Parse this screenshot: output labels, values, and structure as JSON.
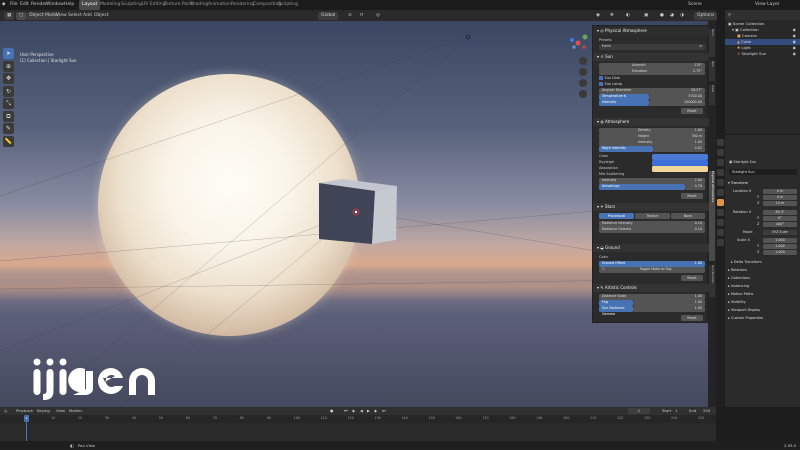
{
  "topbar": {
    "menus": [
      "File",
      "Edit",
      "Render",
      "Window",
      "Help"
    ],
    "workspaces": [
      "Layout",
      "Modeling",
      "Sculpting",
      "UV Editing",
      "Texture Paint",
      "Shading",
      "Animation",
      "Rendering",
      "Compositing",
      "Scripting"
    ],
    "active_workspace": "Layout",
    "scene": "Scene",
    "view_layer": "View Layer"
  },
  "viewport_header": {
    "mode": "Object Mode",
    "menus": [
      "View",
      "Select",
      "Add",
      "Object"
    ],
    "orientation": "Global",
    "options": "Options"
  },
  "viewport_info": {
    "line1": "User Perspective",
    "line2": "(1) Collection | Starlight Sun"
  },
  "logo_text": "ijigen",
  "npanel": {
    "title": "Physical Atmosphere",
    "presets_label": "Presets",
    "preset_value": "Earth",
    "sun": {
      "header": "Sun",
      "azimuth_label": "Azimuth",
      "azimuth": "270°",
      "elevation_label": "Elevation",
      "elevation": "2.72°",
      "sun_disk": "Sun Disk",
      "sun_lamp": "Sun Lamp",
      "angular_label": "Angular Diameter",
      "angular": "28.27°",
      "temp_label": "Temperature K",
      "temp": "5700.00",
      "intensity_label": "Intensity",
      "intensity": "200000.00",
      "reset": "Reset"
    },
    "atmosphere": {
      "header": "Atmosphere",
      "density_label": "Density",
      "density": "1.00",
      "height_label": "Height",
      "height": "780 m",
      "intensity_label": "Intensity",
      "intensity": "1.00",
      "night_label": "Night Intensity",
      "night": "0.02",
      "color_label": "Color",
      "rayleigh_label": "Rayleigh",
      "absorption_label": "Absorption",
      "mie_label": "Mie Scattering",
      "mie_intensity_label": "Intensity",
      "mie_intensity": "2.00",
      "anisotropy_label": "Anisotropy",
      "anisotropy": "0.76",
      "reset": "Reset",
      "colors": {
        "main": "#4a7ad4",
        "rayleigh": "#3c6fd8",
        "absorption": "#f0d49a"
      }
    },
    "stars": {
      "header": "Stars",
      "tabs": [
        "Procedural",
        "Texture",
        "None"
      ],
      "active_tab": "Procedural",
      "rad_intensity_label": "Radiance Intensity",
      "rad_intensity": "0.10",
      "rad_gamma_label": "Radiance Gamma",
      "rad_gamma": "0.10"
    },
    "ground": {
      "header": "Ground",
      "color_label": "Color",
      "offset_label": "Ground Offset",
      "offset": "1.00",
      "toggle": "Toggle Material Fog",
      "reset": "Reset"
    },
    "artistic": {
      "header": "Artistic Controls",
      "distance_label": "Distance Scale",
      "distance": "1.00",
      "fog_label": "Fog",
      "fog": "1.00",
      "sun_rad_label": "Sun Radiance Gamma",
      "sun_rad": "1.00",
      "reset": "Reset"
    }
  },
  "npanel_tabs": [
    "Item",
    "Tool",
    "View",
    "Physical Atmosphere",
    "Sun Position"
  ],
  "outliner": {
    "title": "Scene Collection",
    "items": [
      "Collection",
      "Camera",
      "Cube",
      "Light",
      "Starlight Sun"
    ],
    "selected": "Cube"
  },
  "properties": {
    "object_name": "Starlight Sun",
    "name_field": "Starlight Sun",
    "transform_header": "Transform",
    "location_label": "Location X",
    "loc_x": "0 m",
    "loc_y_label": "Y",
    "loc_y": "0 m",
    "loc_z_label": "Z",
    "loc_z": "10 m",
    "rotation_label": "Rotation X",
    "rot_x": "85.3°",
    "rot_y_label": "Y",
    "rot_y": "0°",
    "rot_z_label": "Z",
    "rot_z": "400°",
    "mode_label": "Mode",
    "mode": "XYZ Euler",
    "scale_label": "Scale X",
    "scale_x": "1.000",
    "scale_y_label": "Y",
    "scale_y": "1.000",
    "scale_z_label": "Z",
    "scale_z": "1.000",
    "sections": [
      "Delta Transform",
      "Relations",
      "Collections",
      "Instancing",
      "Motion Paths",
      "Visibility",
      "Viewport Display",
      "Custom Properties"
    ]
  },
  "timeline": {
    "menus": [
      "Playback",
      "Keying",
      "View",
      "Marker"
    ],
    "current_frame": "1",
    "start_label": "Start",
    "start": "1",
    "end_label": "End",
    "end": "250",
    "ticks": [
      "0",
      "10",
      "20",
      "30",
      "40",
      "50",
      "60",
      "70",
      "80",
      "90",
      "100",
      "110",
      "120",
      "130",
      "140",
      "150",
      "160",
      "170",
      "180",
      "190",
      "200",
      "210",
      "220",
      "230",
      "240",
      "250"
    ]
  },
  "statusbar": {
    "left": "Pan View",
    "version": "2.93.0"
  }
}
